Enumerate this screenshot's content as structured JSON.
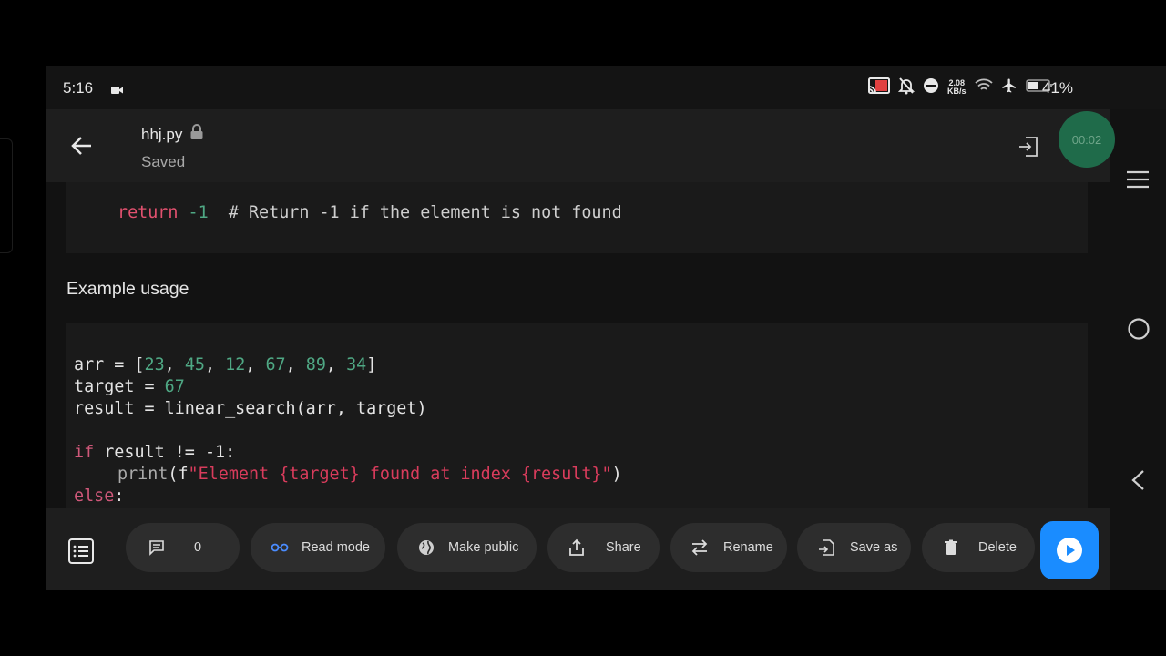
{
  "status_bar": {
    "time": "5:16",
    "net_speed_value": "2.08",
    "net_speed_unit": "KB/s",
    "battery_percent": "41%",
    "icons": [
      "video-record-icon",
      "cast-icon",
      "mute-icon",
      "dnd-icon",
      "wifi-icon",
      "airplane-icon",
      "battery-icon"
    ]
  },
  "app_bar": {
    "file_name": "hhj.py",
    "save_status": "Saved",
    "timer": "00:02"
  },
  "content": {
    "top_code": {
      "keyword": "return",
      "value": "-1",
      "comment": "# Return -1 if the element is not found"
    },
    "example_heading": "Example usage",
    "main_code": {
      "line1": {
        "var": "arr = [",
        "n1": "23",
        "n2": "45",
        "n3": "12",
        "n4": "67",
        "n5": "89",
        "n6": "34",
        "close": "]",
        "sep": ", "
      },
      "line2": {
        "var": "target = ",
        "n": "67"
      },
      "line3": {
        "text": "result = linear_search(arr, target)"
      },
      "line4": {
        "kw": "if",
        "text": " result != ",
        "n": "-1",
        "colon": ":"
      },
      "line5": {
        "fn": "print",
        "pre": "(f",
        "str": "\"Element {target} found at index {result}\"",
        "post": ")"
      },
      "line6": {
        "kw": "else",
        "colon": ":"
      }
    }
  },
  "toolbar": {
    "comments_count": "0",
    "read_mode": "Read mode",
    "make_public": "Make public",
    "share": "Share",
    "rename": "Rename",
    "save_as": "Save as",
    "delete": "Delete"
  },
  "colors": {
    "run_button": "#1a8cff",
    "timer": "#1f6b4a",
    "number": "#4fa884",
    "keyword": "#d0587a",
    "string": "#d93c5c"
  }
}
